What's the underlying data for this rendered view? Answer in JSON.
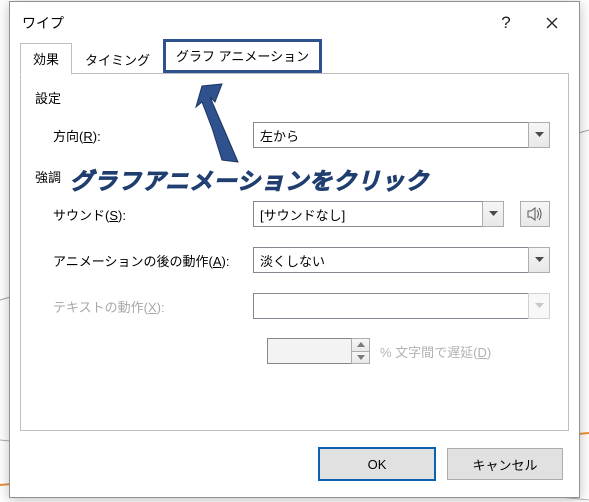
{
  "window": {
    "title": "ワイプ",
    "help_tooltip": "?",
    "close_tooltip": "閉じる"
  },
  "tabs": [
    {
      "id": "effect",
      "label": "効果",
      "active": true
    },
    {
      "id": "timing",
      "label": "タイミング",
      "active": false
    },
    {
      "id": "chartanim",
      "label": "グラフ アニメーション",
      "active": false,
      "highlighted": true
    }
  ],
  "panel": {
    "section_settings": "設定",
    "section_emphasis": "強調",
    "direction": {
      "label_pre": "方向(",
      "label_u": "R",
      "label_post": "):",
      "value": "左から"
    },
    "sound": {
      "label_pre": "サウンド(",
      "label_u": "S",
      "label_post": "):",
      "value": "[サウンドなし]"
    },
    "afterAnim": {
      "label_pre": "アニメーションの後の動作(",
      "label_u": "A",
      "label_post": "):",
      "value": "淡くしない"
    },
    "textAnim": {
      "label_pre": "テキストの動作(",
      "label_u": "X",
      "label_post": "):",
      "value": ""
    },
    "delay": {
      "value": "",
      "label_pre": "% 文字間で遅延(",
      "label_u": "D",
      "label_post": ")"
    }
  },
  "footer": {
    "ok": "OK",
    "cancel": "キャンセル"
  },
  "annotation": {
    "text": "グラフアニメーションをクリック"
  }
}
